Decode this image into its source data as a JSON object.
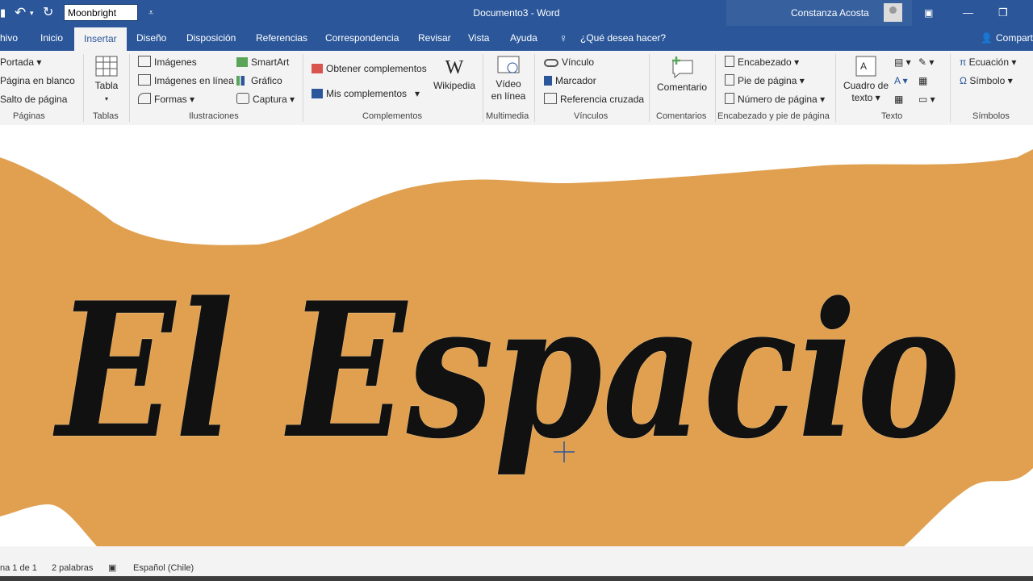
{
  "titlebar": {
    "font_value": "Moonbright",
    "doc_title": "Documento3 - Word",
    "user_name": "Constanza Acosta"
  },
  "tabs": [
    "hivo",
    "Inicio",
    "Insertar",
    "Diseño",
    "Disposición",
    "Referencias",
    "Correspondencia",
    "Revisar",
    "Vista",
    "Ayuda",
    "¿Qué desea hacer?",
    "Compart"
  ],
  "ribbon": {
    "paginas": {
      "items": [
        "Portada",
        "Página en blanco",
        "Salto de página"
      ],
      "group": "Páginas"
    },
    "tablas": {
      "label": "Tabla",
      "group": "Tablas"
    },
    "ilustraciones": {
      "items": [
        "Imágenes",
        "Imágenes en línea",
        "Formas",
        "SmartArt",
        "Gráfico",
        "Captura"
      ],
      "group": "Ilustraciones"
    },
    "complementos": {
      "items": [
        "Obtener complementos",
        "Mis complementos",
        "Wikipedia"
      ],
      "group": "Complementos"
    },
    "multimedia": {
      "label1": "Vídeo",
      "label2": "en línea",
      "group": "Multimedia"
    },
    "vinculos": {
      "items": [
        "Vínculo",
        "Marcador",
        "Referencia cruzada"
      ],
      "group": "Vínculos"
    },
    "comentarios": {
      "label": "Comentario",
      "group": "Comentarios"
    },
    "encabezado": {
      "items": [
        "Encabezado",
        "Pie de página",
        "Número de página"
      ],
      "group": "Encabezado y pie de página"
    },
    "texto": {
      "label1": "Cuadro de",
      "label2": "texto",
      "group": "Texto"
    },
    "simbolos": {
      "items": [
        "Ecuación",
        "Símbolo"
      ],
      "group": "Símbolos"
    }
  },
  "document": {
    "headline": "El Espacio"
  },
  "status": {
    "page": "na 1 de 1",
    "words": "2 palabras",
    "language": "Español (Chile)"
  },
  "colors": {
    "brand": "#2b579a",
    "banner": "#e0a050"
  }
}
